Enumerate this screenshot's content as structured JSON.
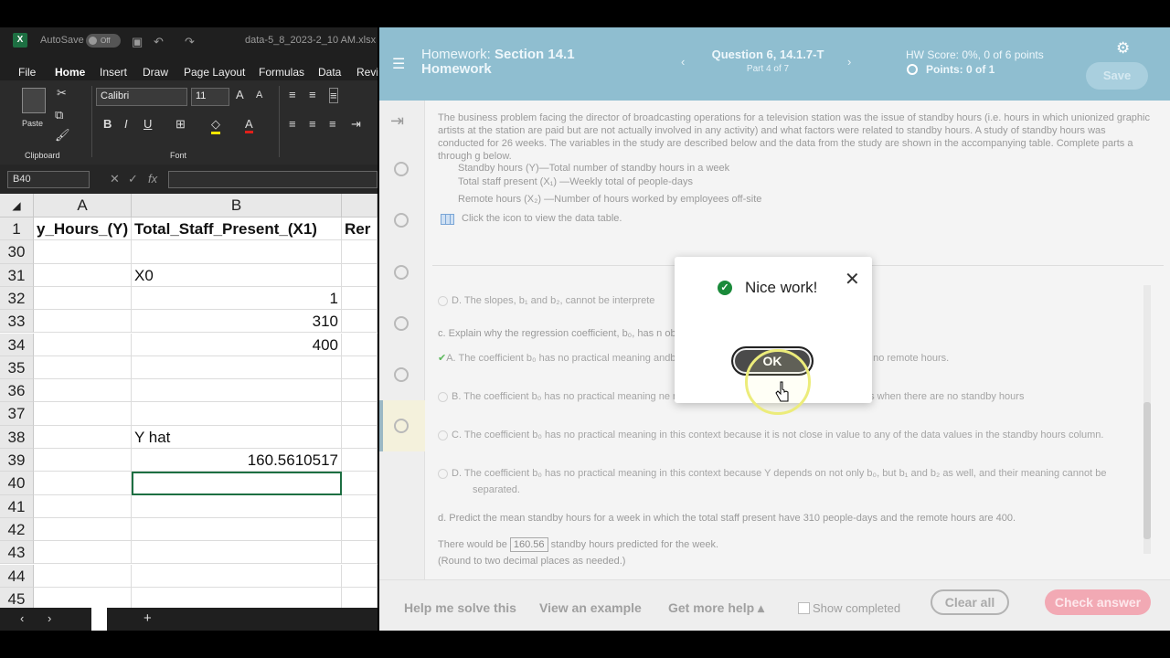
{
  "excel": {
    "autosave_label": "AutoSave",
    "autosave_state": "Off",
    "filename": "data-5_8_2023-2_10 AM.xlsx",
    "menu": [
      "File",
      "Home",
      "Insert",
      "Draw",
      "Page Layout",
      "Formulas",
      "Data",
      "Revi"
    ],
    "ribbon": {
      "paste_label": "Paste",
      "clipboard_label": "Clipboard",
      "font_name": "Calibri",
      "font_size": "11",
      "font_label": "Font",
      "bold": "B",
      "italic": "I",
      "underline": "U"
    },
    "name_box": "B40",
    "fx_label": "fx",
    "columns": [
      "A",
      "B"
    ],
    "header_row": {
      "num": "1",
      "a": "y_Hours_(Y)",
      "b": "Total_Staff_Present_(X1)",
      "c": "Rer"
    },
    "rows": [
      {
        "num": "30",
        "b": ""
      },
      {
        "num": "31",
        "b": "X0"
      },
      {
        "num": "32",
        "b": "1"
      },
      {
        "num": "33",
        "b": "310"
      },
      {
        "num": "34",
        "b": "400"
      },
      {
        "num": "35",
        "b": ""
      },
      {
        "num": "36",
        "b": ""
      },
      {
        "num": "37",
        "b": ""
      },
      {
        "num": "38",
        "b": "Y hat"
      },
      {
        "num": "39",
        "b": "160.5610517"
      },
      {
        "num": "40",
        "b": ""
      },
      {
        "num": "41",
        "b": ""
      },
      {
        "num": "42",
        "b": ""
      },
      {
        "num": "43",
        "b": ""
      },
      {
        "num": "44",
        "b": ""
      },
      {
        "num": "45",
        "b": ""
      }
    ],
    "sheet_add": "+"
  },
  "mylab": {
    "title_prefix": "Homework:",
    "title_section": "Section 14.1",
    "title_line2": "Homework",
    "question_title": "Question 6, 14.1.7-T",
    "part": "Part 4 of 7",
    "hw_score": "HW Score: 0%, 0 of 6 points",
    "points": "Points: 0 of 1",
    "save_label": "Save",
    "problem_text": "The business problem facing the director of broadcasting operations for a television station was the issue of standby hours (i.e. hours in which unionized graphic artists at the station are paid but are not actually involved in any activity) and what factors were related to standby hours. A study of standby hours was conducted for 26 weeks. The variables in the study are described below and the data from the study are shown in the accompanying table. Complete parts a through g below.",
    "var1": "Standby hours (Y)—Total number of standby hours in a week",
    "var2": "Total staff present (X₁) —Weekly total of people-days",
    "var3": "Remote hours (X₂) —Number of hours worked by employees off-site",
    "table_link": "Click the icon to view the data table.",
    "opt_prev_d": "D.   The slopes, b₁ and b₂, cannot be interprete",
    "part_c": "c. Explain why the regression coefficient, b₀, has n                                                      oblem. Choose the correct answer below",
    "opt_a": "A.   The coefficient b₀ has no practical meaning                                                          andby hours when there are no staff present and no remote hours.",
    "opt_b": "B.   The coefficient b₀ has no practical meaning                                                          ne number of staff present and the remote hours when there are no standby hours",
    "opt_c": "C.   The coefficient b₀ has no practical meaning in this context because it is not close in value to any of the data values in the standby hours column.",
    "opt_d": "D.   The coefficient b₀ has no practical meaning in this context because Y depends on not only b₀, but b₁ and b₂ as well, and their meaning cannot be separated.",
    "part_d": "d. Predict the mean standby hours for a week in which the total staff present have 310 people-days and the remote hours are 400.",
    "answer_pre": "There would be",
    "answer_value": "160.56",
    "answer_post": "standby hours predicted for the week.",
    "round_note": "(Round to two decimal places as needed.)",
    "footer": {
      "help": "Help me solve this",
      "example": "View an example",
      "more_help": "Get more help ▴",
      "show_completed": "Show completed",
      "clear_all": "Clear all",
      "check_answer": "Check answer"
    },
    "dialog": {
      "message": "Nice work!",
      "ok": "OK"
    }
  }
}
